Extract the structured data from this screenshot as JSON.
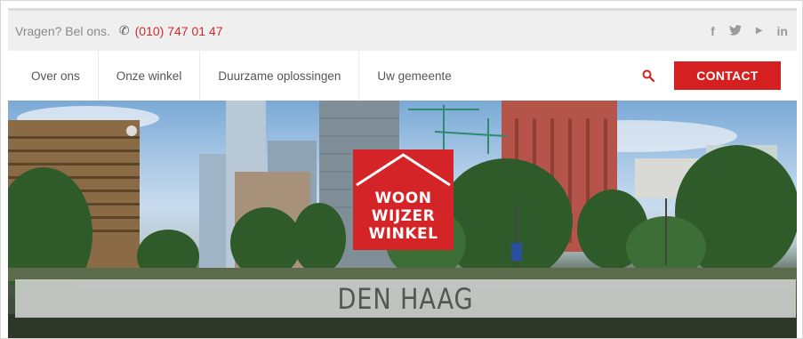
{
  "topbar": {
    "question": "Vragen? Bel ons.",
    "phone": "(010) 747 01 47",
    "phone_icon": "phone-icon",
    "social": [
      {
        "icon": "facebook-icon",
        "glyph": "f"
      },
      {
        "icon": "twitter-icon",
        "glyph": "🐦"
      },
      {
        "icon": "youtube-icon",
        "glyph": "▶"
      },
      {
        "icon": "linkedin-icon",
        "glyph": "in"
      }
    ]
  },
  "nav": {
    "items": [
      "Over ons",
      "Onze winkel",
      "Duurzame oplossingen",
      "Uw gemeente"
    ],
    "search_icon": "search-icon",
    "contact_label": "CONTACT"
  },
  "hero": {
    "logo_lines": [
      "WOON",
      "WIJZER",
      "WINKEL"
    ],
    "city": "DEN HAAG"
  },
  "colors": {
    "accent": "#d42020",
    "topbar_bg": "#efefef",
    "phone_text": "#cf2a2a"
  }
}
